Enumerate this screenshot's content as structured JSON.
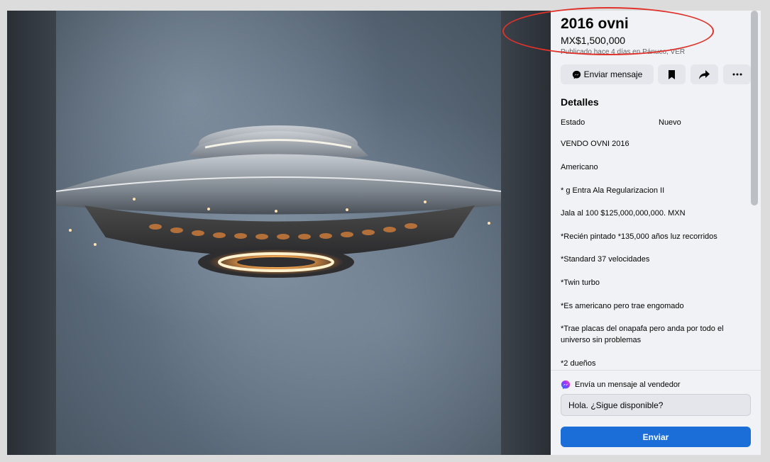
{
  "listing": {
    "title": "2016 ovni",
    "price": "MX$1,500,000",
    "meta": "Publicado hace 4 días en Pánuco, VER"
  },
  "actions": {
    "message_label": "Enviar mensaje",
    "save_icon": "bookmark-icon",
    "share_icon": "share-arrow-icon",
    "more_icon": "ellipsis-icon"
  },
  "details": {
    "section_title": "Detalles",
    "condition_label": "Estado",
    "condition_value": "Nuevo",
    "description": [
      "VENDO OVNI 2016",
      "Americano",
      "* g Entra Ala Regularizacion II",
      "Jala al 100 $125,000,000,000. MXN",
      "*Recién pintado *135,000 años luz recorridos",
      "*Standard 37 velocidades",
      "*Twin turbo",
      "*Es americano pero trae engomado",
      "*Trae placas del onapafa pero anda por todo el universo sin problemas",
      "*2 dueños"
    ]
  },
  "seller_message": {
    "label": "Envía un mensaje al vendedor",
    "input_value": "Hola. ¿Sigue disponible?",
    "send_label": "Enviar"
  },
  "colors": {
    "highlight": "#e0322a",
    "primary_button": "#1b6ed8",
    "messenger": "#a033ff"
  }
}
